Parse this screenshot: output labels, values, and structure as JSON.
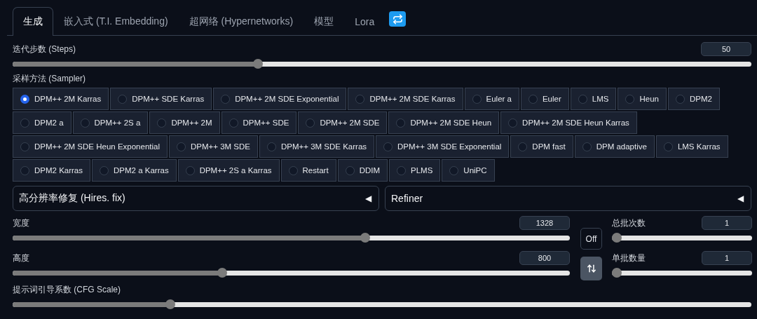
{
  "tabs": [
    {
      "label": "生成",
      "selected": true
    },
    {
      "label": "嵌入式 (T.I. Embedding)",
      "selected": false
    },
    {
      "label": "超网络 (Hypernetworks)",
      "selected": false
    },
    {
      "label": "模型",
      "selected": false
    },
    {
      "label": "Lora",
      "selected": false
    }
  ],
  "steps": {
    "label": "迭代步数 (Steps)",
    "value": "50",
    "level": 0.33
  },
  "sampler": {
    "label": "采样方法 (Sampler)",
    "options": [
      {
        "label": "DPM++ 2M Karras",
        "selected": true
      },
      {
        "label": "DPM++ SDE Karras",
        "selected": false
      },
      {
        "label": "DPM++ 2M SDE Exponential",
        "selected": false
      },
      {
        "label": "DPM++ 2M SDE Karras",
        "selected": false
      },
      {
        "label": "Euler a",
        "selected": false
      },
      {
        "label": "Euler",
        "selected": false
      },
      {
        "label": "LMS",
        "selected": false
      },
      {
        "label": "Heun",
        "selected": false
      },
      {
        "label": "DPM2",
        "selected": false
      },
      {
        "label": "DPM2 a",
        "selected": false
      },
      {
        "label": "DPM++ 2S a",
        "selected": false
      },
      {
        "label": "DPM++ 2M",
        "selected": false
      },
      {
        "label": "DPM++ SDE",
        "selected": false
      },
      {
        "label": "DPM++ 2M SDE",
        "selected": false
      },
      {
        "label": "DPM++ 2M SDE Heun",
        "selected": false
      },
      {
        "label": "DPM++ 2M SDE Heun Karras",
        "selected": false
      },
      {
        "label": "DPM++ 2M SDE Heun Exponential",
        "selected": false
      },
      {
        "label": "DPM++ 3M SDE",
        "selected": false
      },
      {
        "label": "DPM++ 3M SDE Karras",
        "selected": false
      },
      {
        "label": "DPM++ 3M SDE Exponential",
        "selected": false
      },
      {
        "label": "DPM fast",
        "selected": false
      },
      {
        "label": "DPM adaptive",
        "selected": false
      },
      {
        "label": "LMS Karras",
        "selected": false
      },
      {
        "label": "DPM2 Karras",
        "selected": false
      },
      {
        "label": "DPM2 a Karras",
        "selected": false
      },
      {
        "label": "DPM++ 2S a Karras",
        "selected": false
      },
      {
        "label": "Restart",
        "selected": false
      },
      {
        "label": "DDIM",
        "selected": false
      },
      {
        "label": "PLMS",
        "selected": false
      },
      {
        "label": "UniPC",
        "selected": false
      }
    ]
  },
  "accordions": [
    {
      "label": "高分辨率修复 (Hires. fix)",
      "arrow": "◀",
      "expanded": false
    },
    {
      "label": "Refiner",
      "arrow": "◀",
      "expanded": false
    }
  ],
  "width": {
    "label": "宽度",
    "value": "1328",
    "level": 0.635
  },
  "height": {
    "label": "高度",
    "value": "800",
    "level": 0.374
  },
  "off_button": "Off",
  "batch_count": {
    "label": "总批次数",
    "value": "1",
    "level": 0
  },
  "batch_size": {
    "label": "单批数量",
    "value": "1",
    "level": 0
  },
  "cfg": {
    "label": "提示词引导系数 (CFG Scale)",
    "level": 0.21
  }
}
